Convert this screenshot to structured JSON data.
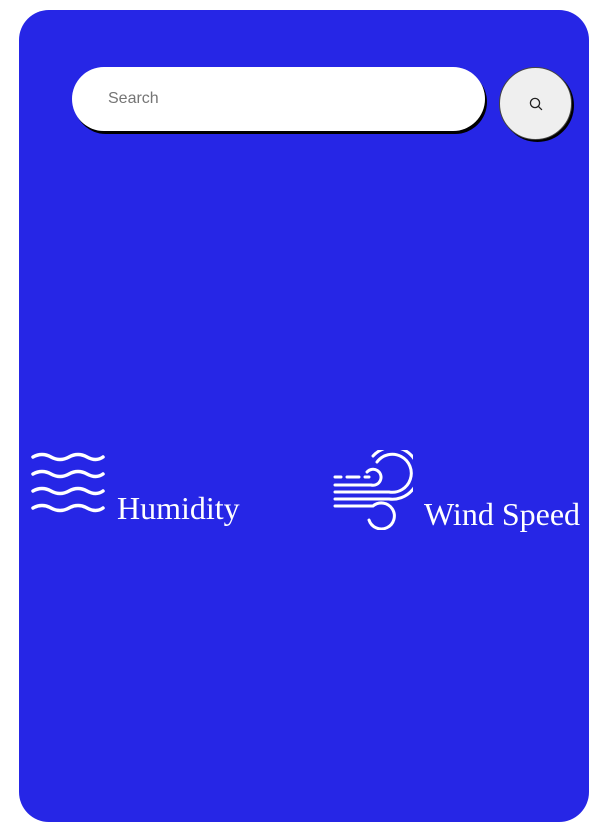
{
  "search": {
    "placeholder": "Search",
    "value": "",
    "button_icon": "search-icon"
  },
  "details": {
    "humidity": {
      "icon": "humidity-waves-icon",
      "label": "Humidity"
    },
    "wind": {
      "icon": "wind-icon",
      "label": "Wind Speed"
    }
  },
  "colors": {
    "card_background": "#2626e6",
    "text": "#ffffff",
    "search_field": "#ffffff",
    "search_button": "#efefef"
  }
}
